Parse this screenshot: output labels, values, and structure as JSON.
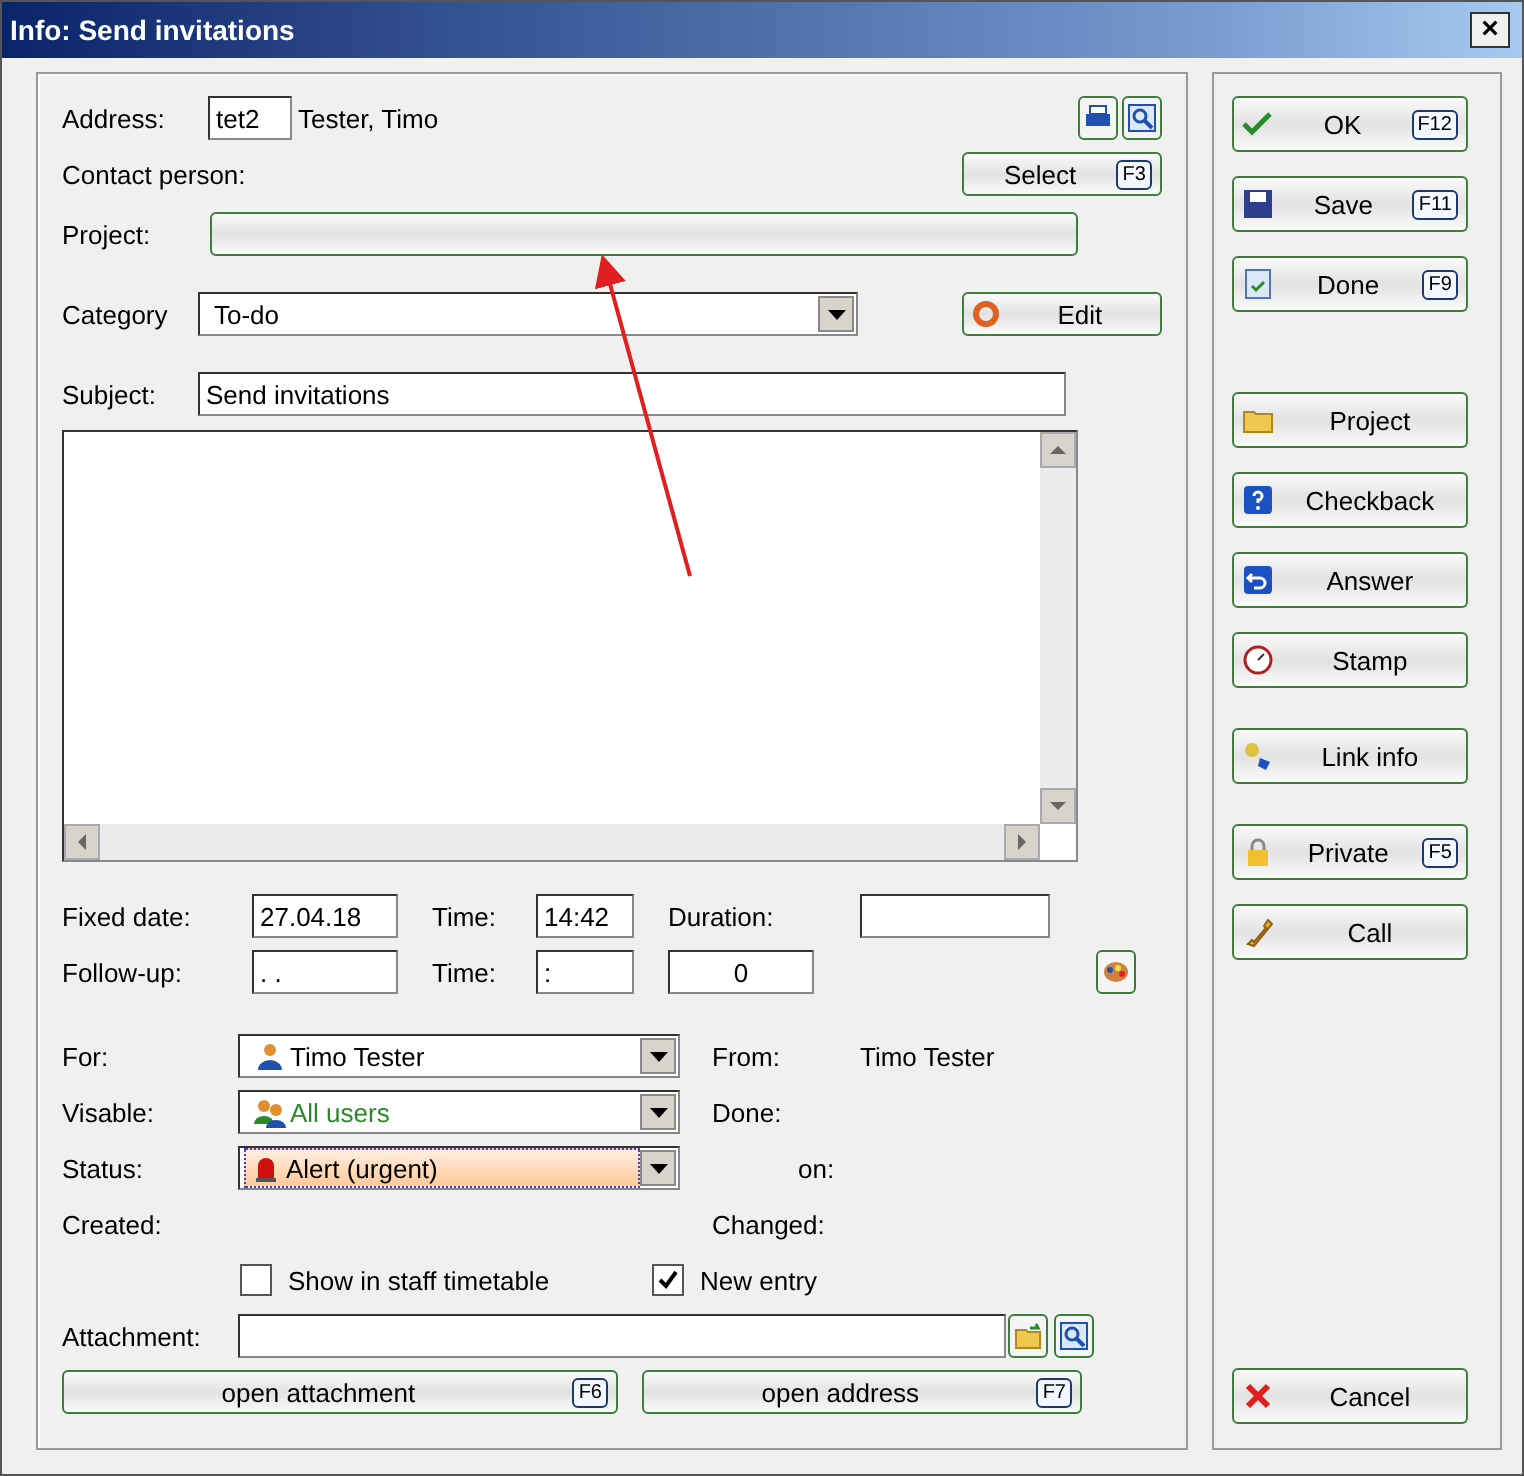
{
  "window": {
    "title": "Info: Send invitations",
    "close": "×"
  },
  "address": {
    "label": "Address:",
    "code": "tet2",
    "name": "Tester, Timo"
  },
  "contact": {
    "label": "Contact person:",
    "button": {
      "label": "Select",
      "key": "F3"
    }
  },
  "project": {
    "label": "Project:"
  },
  "category": {
    "label": "Category",
    "value": "To-do",
    "button": {
      "label": "Edit"
    }
  },
  "subject": {
    "label": "Subject:",
    "value": "Send invitations"
  },
  "dates": {
    "fixed_label": "Fixed date:",
    "fixed_value": "27.04.18",
    "time_label": "Time:",
    "time_value": "14:42",
    "duration_label": "Duration:",
    "followup_label": "Follow-up:",
    "followup_value": ". .",
    "time2_label": "Time:",
    "time2_value": ":",
    "count_value": "0"
  },
  "people": [
    {
      "label": "For:",
      "value": "Timo Tester",
      "kind": "user",
      "color": "#000000",
      "focused": false,
      "side_label": "From:",
      "side_value": "Timo Tester"
    },
    {
      "label": "Visable:",
      "value": "All users",
      "kind": "users",
      "color": "#2a8a2a",
      "focused": false,
      "side_label": "Done:"
    },
    {
      "label": "Status:",
      "value": "Alert (urgent)",
      "kind": "alert",
      "color": "#000000",
      "focused": true,
      "side_label": "on:"
    }
  ],
  "created": {
    "label": "Created:",
    "side_label": "Changed:"
  },
  "checkboxes": [
    {
      "label": "Show in staff timetable",
      "checked": false
    },
    {
      "label": "New entry",
      "checked": true
    }
  ],
  "attachment": {
    "label": "Attachment:"
  },
  "bottom_buttons": [
    {
      "label": "open attachment",
      "key": "F6"
    },
    {
      "label": "open address",
      "key": "F7"
    }
  ],
  "side_groups": [
    [
      {
        "label": "OK",
        "key": "F12",
        "kind": "check"
      },
      {
        "label": "Save",
        "key": "F11",
        "kind": "save"
      },
      {
        "label": "Done",
        "key": "F9",
        "kind": "done"
      }
    ],
    [
      {
        "label": "Project",
        "kind": "folder"
      },
      {
        "label": "Checkback",
        "kind": "question"
      },
      {
        "label": "Answer",
        "kind": "answer"
      },
      {
        "label": "Stamp",
        "kind": "stamp"
      }
    ],
    [
      {
        "label": "Link info",
        "kind": "link"
      }
    ],
    [
      {
        "label": "Private",
        "key": "F5",
        "kind": "lock"
      },
      {
        "label": "Call",
        "kind": "phone"
      }
    ],
    [
      {
        "label": "Cancel",
        "kind": "cancel"
      }
    ]
  ]
}
